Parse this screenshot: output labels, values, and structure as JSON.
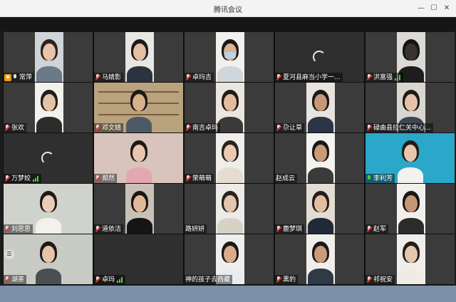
{
  "app": {
    "title": "腾讯会议"
  },
  "window_controls": {
    "minimize": "—",
    "maximize": "☐",
    "close": "✕"
  },
  "participants": [
    {
      "name": "常萍",
      "host": true,
      "video": true,
      "muted": false
    },
    {
      "name": "马婧影",
      "muted": true,
      "video": true
    },
    {
      "name": "卓玛吉",
      "muted": true,
      "video": true
    },
    {
      "name": "夏河县麻当小学一...",
      "muted": true,
      "video": false,
      "loading": true
    },
    {
      "name": "洪富强",
      "muted": true,
      "video": true,
      "signal": true
    },
    {
      "name": "张欢",
      "muted": true,
      "video": true
    },
    {
      "name": "邓文婧",
      "muted": true,
      "video": true
    },
    {
      "name": "南吉卓玛",
      "muted": true,
      "video": true
    },
    {
      "name": "尕让草",
      "muted": true,
      "video": true
    },
    {
      "name": "碌曲县拉仁关中心...",
      "muted": true,
      "video": true
    },
    {
      "name": "万梦姣",
      "muted": true,
      "video": false,
      "loading": true,
      "signal": true
    },
    {
      "name": "郑然",
      "muted": true,
      "video": true
    },
    {
      "name": "荣萌萌",
      "muted": true,
      "video": true
    },
    {
      "name": "赵成云",
      "muted": false,
      "noicon": true,
      "video": true
    },
    {
      "name": "李利芳",
      "muted": false,
      "active": true,
      "video": true
    },
    {
      "name": "刘思思",
      "muted": true,
      "video": true
    },
    {
      "name": "道依洁",
      "muted": true,
      "video": true
    },
    {
      "name": "路妍妍",
      "muted": false,
      "noicon": true,
      "video": true
    },
    {
      "name": "鹿梦琪",
      "muted": true,
      "video": true
    },
    {
      "name": "赵军",
      "muted": true,
      "video": true
    },
    {
      "name": "湖茶",
      "muted": true,
      "video": true
    },
    {
      "name": "卓玛",
      "muted": true,
      "video": false,
      "signal": true
    },
    {
      "name": "神的孩子去西藏",
      "muted": false,
      "noicon": true,
      "video": true
    },
    {
      "name": "黑豹",
      "muted": true,
      "video": true
    },
    {
      "name": "祁祝安",
      "muted": true,
      "video": true
    }
  ]
}
